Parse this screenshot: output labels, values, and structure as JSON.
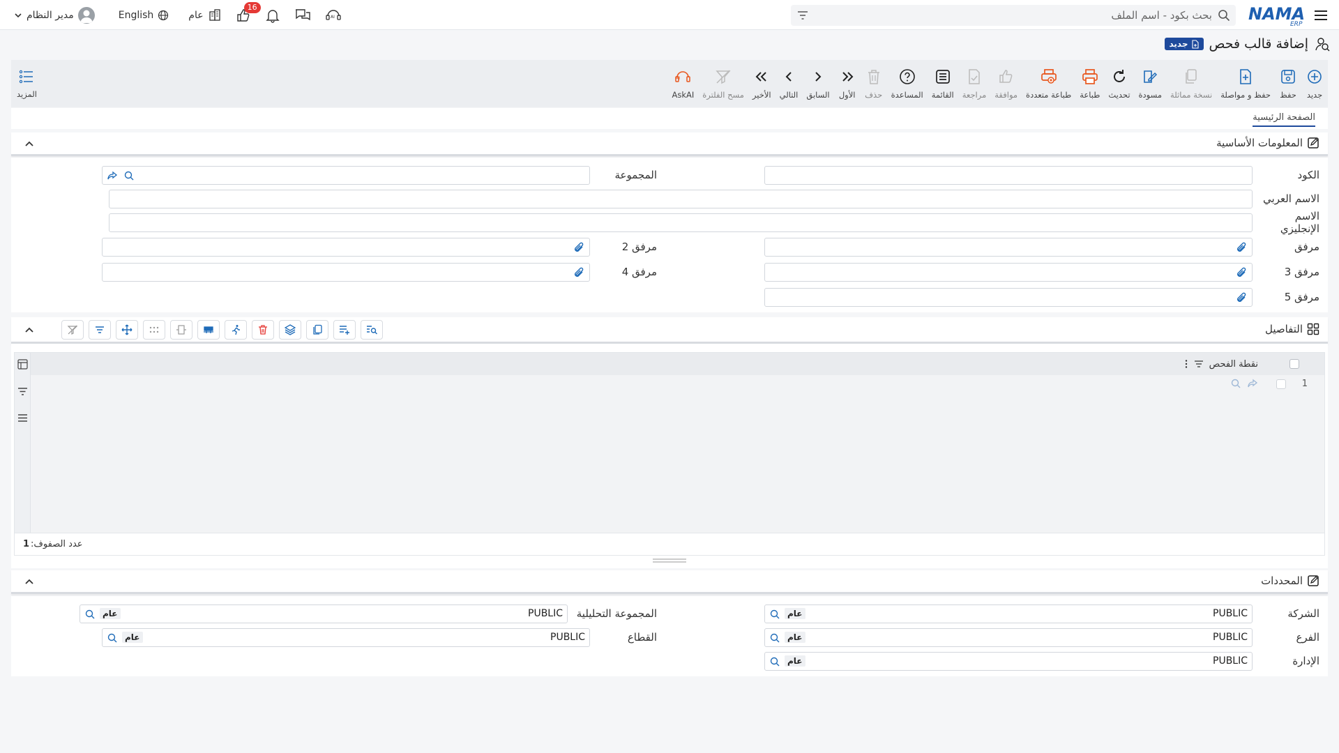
{
  "topbar": {
    "search_placeholder": "بحث بكود - اسم الملف",
    "logo_text": "NAMA",
    "logo_sub": "ERP",
    "user_name": "مدير النظام",
    "language": "English",
    "scope": "عام",
    "notification_count": "16"
  },
  "page": {
    "title": "إضافة قالب فحص",
    "status_badge": "جديد"
  },
  "toolbar": {
    "items": [
      {
        "label": "جديد",
        "icon": "plus-circle-icon"
      },
      {
        "label": "حفظ",
        "icon": "save-icon"
      },
      {
        "label": "حفظ و مواصلة",
        "icon": "save-continue-icon"
      },
      {
        "label": "نسخة مماثلة",
        "icon": "duplicate-icon"
      },
      {
        "label": "مسودة",
        "icon": "draft-icon"
      },
      {
        "label": "تحديث",
        "icon": "refresh-icon"
      },
      {
        "label": "طباعة",
        "icon": "print-icon"
      },
      {
        "label": "طباعة متعددة",
        "icon": "multi-print-icon"
      },
      {
        "label": "موافقة",
        "icon": "approve-icon"
      },
      {
        "label": "مراجعة",
        "icon": "review-icon"
      },
      {
        "label": "القائمة",
        "icon": "list-icon"
      },
      {
        "label": "المساعدة",
        "icon": "help-icon"
      },
      {
        "label": "حذف",
        "icon": "delete-icon"
      },
      {
        "label": "الأول",
        "icon": "first-icon"
      },
      {
        "label": "السابق",
        "icon": "previous-icon"
      },
      {
        "label": "التالي",
        "icon": "next-icon"
      },
      {
        "label": "الأخير",
        "icon": "last-icon"
      },
      {
        "label": "مسح الفلترة",
        "icon": "clear-filter-icon"
      },
      {
        "label": "AskAI",
        "icon": "ask-ai-icon"
      }
    ],
    "more_label": "المزيد"
  },
  "tabs": {
    "main": "الصفحة الرئيسية"
  },
  "basic_info": {
    "title": "المعلومات الأساسية",
    "code_label": "الكود",
    "group_label": "المجموعة",
    "arabic_name_label": "الاسم العربي",
    "english_name_label": "الاسم الإنجليزي",
    "attachment_label": "مرفق",
    "attachment2_label": "مرفق 2",
    "attachment3_label": "مرفق 3",
    "attachment4_label": "مرفق 4",
    "attachment5_label": "مرفق 5"
  },
  "details": {
    "title": "التفاصيل",
    "column_header": "نقطة الفحص",
    "row_number": "1",
    "row_count_label": "عدد الصفوف:",
    "row_count": "1"
  },
  "determinants": {
    "title": "المحددات",
    "company_label": "الشركة",
    "analytic_group_label": "المجموعة التحليلية",
    "branch_label": "الفرع",
    "sector_label": "القطاع",
    "department_label": "الإدارة",
    "value": "PUBLIC",
    "tag": "عام"
  }
}
